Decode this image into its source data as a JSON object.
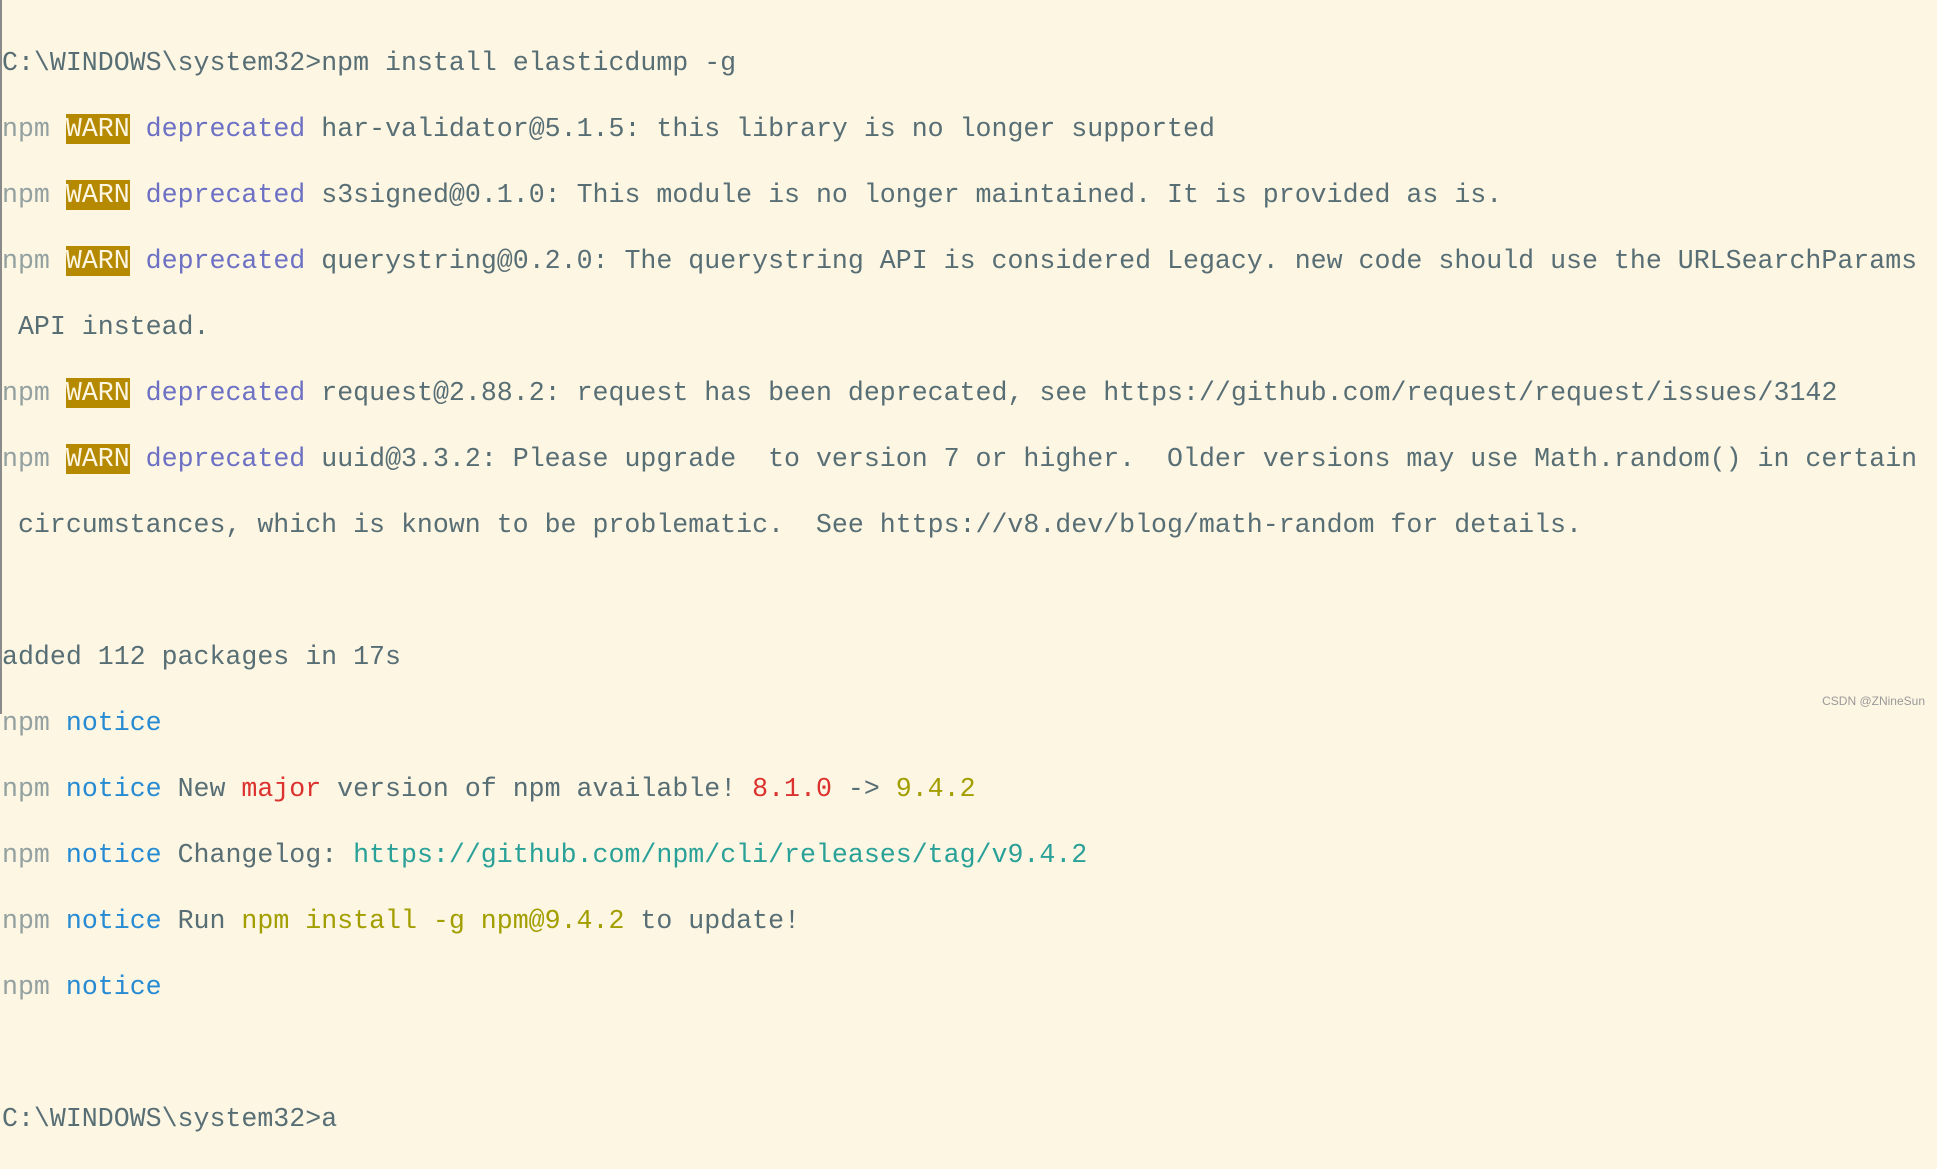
{
  "terminal": {
    "prompt": "C:\\WINDOWS\\system32>",
    "command": "npm install elasticdump -g",
    "npm": "npm",
    "warn": "WARN",
    "deprecated": "deprecated",
    "notice": "notice",
    "warnings": [
      "har-validator@5.1.5: this library is no longer supported",
      "s3signed@0.1.0: This module is no longer maintained. It is provided as is.",
      "querystring@0.2.0: The querystring API is considered Legacy. new code should use the URLSearchParams",
      "request@2.88.2: request has been deprecated, see https://github.com/request/request/issues/3142",
      "uuid@3.3.2: Please upgrade  to version 7 or higher.  Older versions may use Math.random() in certain"
    ],
    "wrap1": " API instead.",
    "wrap2": " circumstances, which is known to be problematic.  See https://v8.dev/blog/math-random for details.",
    "added": "added 112 packages in 17s",
    "new_pre": " New ",
    "major": "major",
    "new_mid": " version of npm available! ",
    "old_ver": "8.1.0",
    "arrow": " -> ",
    "new_ver": "9.4.2",
    "changelog_label": " Changelog: ",
    "changelog_url": "https://github.com/npm/cli/releases/tag/v9.4.2",
    "run_label": " Run ",
    "run_cmd": "npm install -g npm@9.4.2",
    "run_post": " to update!",
    "last_input": "a"
  },
  "watermark": "CSDN @ZNineSun",
  "colors": {
    "background": "#fdf6e3",
    "warn_bg": "#b58900",
    "deprecated": "#6c71c4",
    "notice": "#268bd2"
  }
}
